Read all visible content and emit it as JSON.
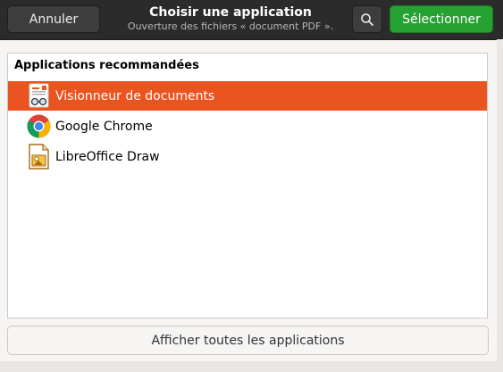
{
  "header": {
    "cancel_label": "Annuler",
    "title": "Choisir une application",
    "subtitle": "Ouverture des fichiers « document PDF ».",
    "select_label": "Sélectionner",
    "search_icon": "search-icon"
  },
  "list": {
    "heading": "Applications recommandées",
    "items": [
      {
        "label": "Visionneur de documents",
        "icon": "document-viewer-icon",
        "selected": true
      },
      {
        "label": "Google Chrome",
        "icon": "chrome-icon",
        "selected": false
      },
      {
        "label": "LibreOffice Draw",
        "icon": "libreoffice-draw-icon",
        "selected": false
      }
    ]
  },
  "footer": {
    "show_all_label": "Afficher toutes les applications"
  },
  "colors": {
    "header_bg": "#2b2b2b",
    "accent_selection": "#e95420",
    "suggested_action": "#26a232"
  }
}
